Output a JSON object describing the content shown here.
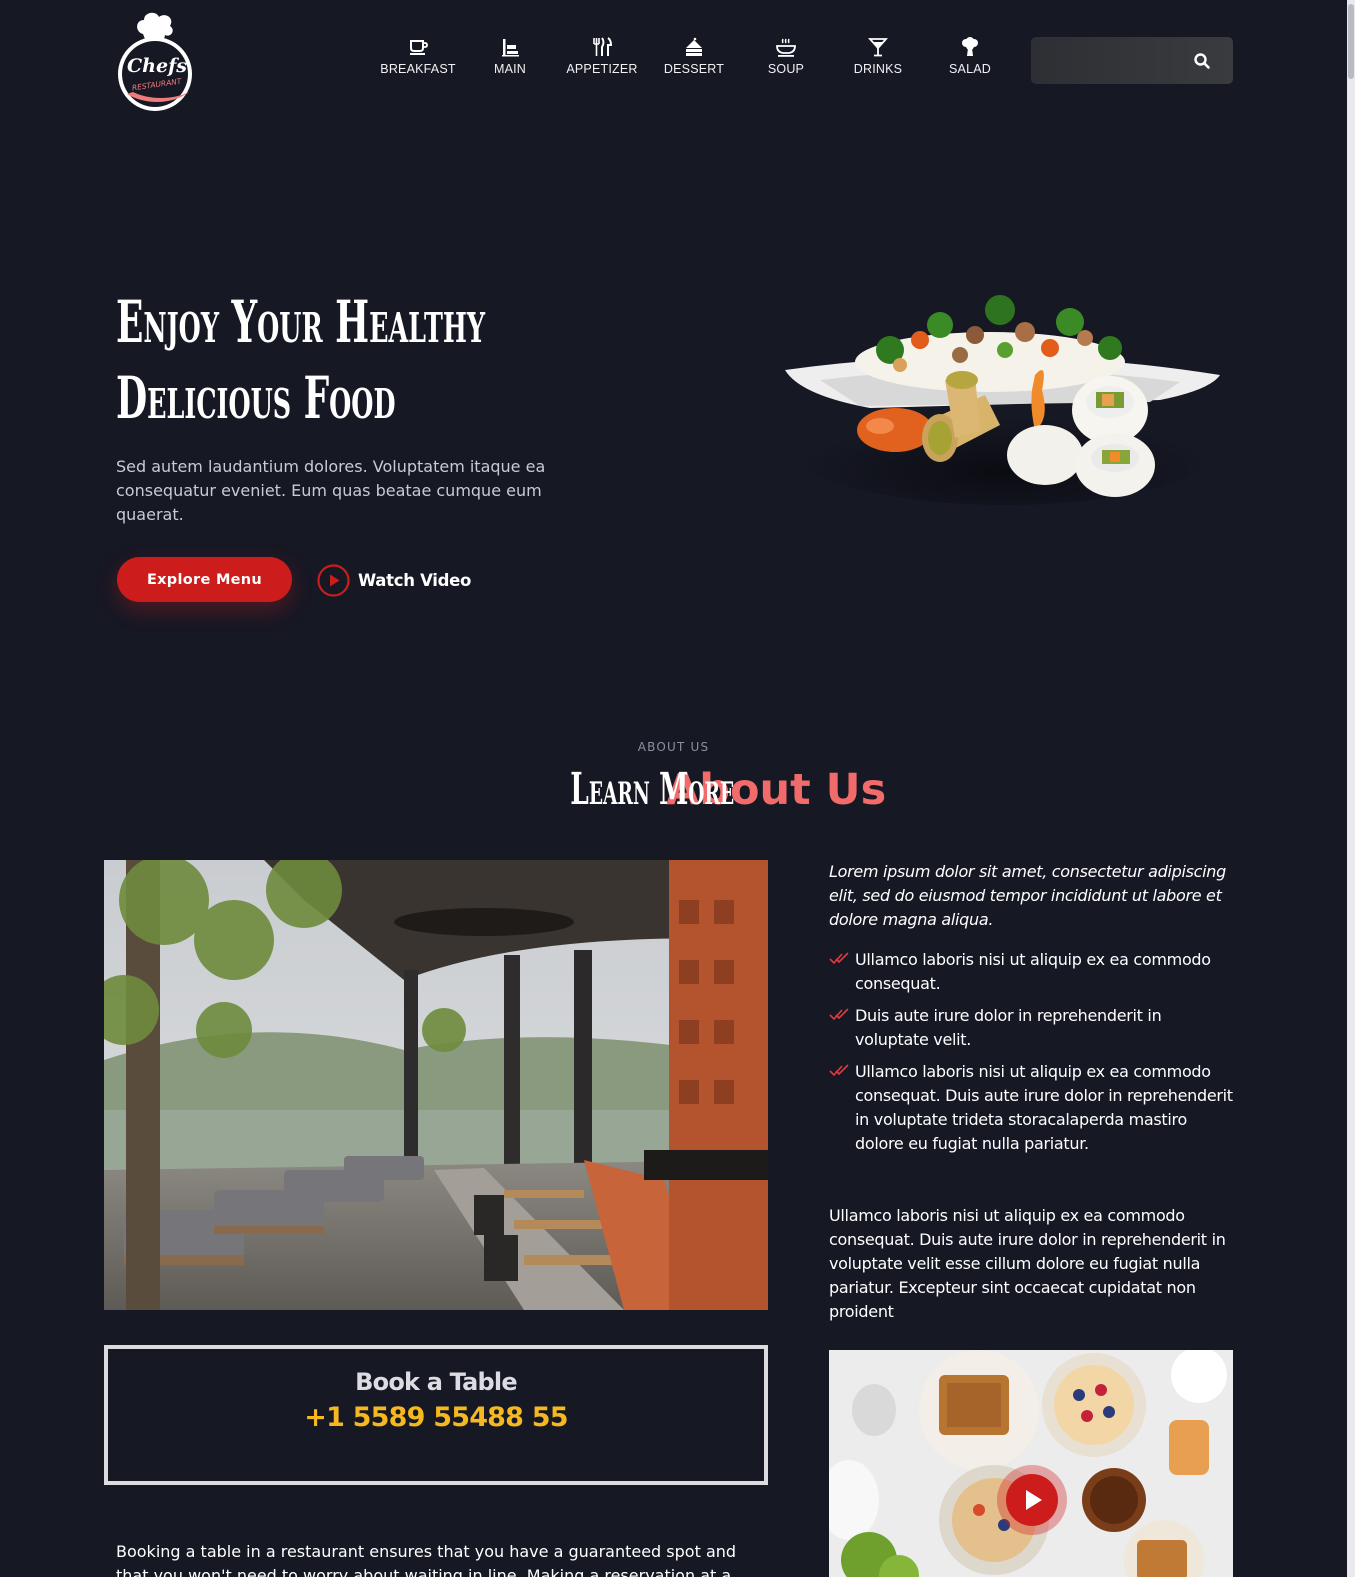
{
  "brand": {
    "logo_text": "Chefs",
    "logo_sub": "RESTAURANT"
  },
  "nav": {
    "items": [
      {
        "label": "BREAKFAST",
        "icon": "coffee-cup-icon"
      },
      {
        "label": "MAIN",
        "icon": "main-dish-icon"
      },
      {
        "label": "APPETIZER",
        "icon": "fork-knife-icon"
      },
      {
        "label": "DESSERT",
        "icon": "cake-icon"
      },
      {
        "label": "SOUP",
        "icon": "soup-bowl-icon"
      },
      {
        "label": "DRINKS",
        "icon": "cocktail-glass-icon"
      },
      {
        "label": "SALAD",
        "icon": "broccoli-icon"
      }
    ]
  },
  "search": {
    "value": "",
    "placeholder": "",
    "icon": "search-icon"
  },
  "hero": {
    "title_line1": "Enjoy Your Healthy",
    "title_line2": "Delicious Food",
    "text": "Sed autem laudantium dolores. Voluptatem itaque ea consequatur eveniet. Eum quas beatae cumque eum quaerat.",
    "explore_label": "Explore Menu",
    "watch_label": "Watch Video"
  },
  "about": {
    "subtitle": "ABOUT US",
    "title_part1": "Learn More",
    "title_part2": "About Us",
    "lead": "Lorem ipsum dolor sit amet, consectetur adipiscing elit, sed do eiusmod tempor incididunt ut labore et dolore magna aliqua.",
    "checks": [
      "Ullamco laboris nisi ut aliquip ex ea commodo consequat.",
      "Duis aute irure dolor in reprehenderit in voluptate velit.",
      "Ullamco laboris nisi ut aliquip ex ea commodo consequat. Duis aute irure dolor in reprehenderit in voluptate trideta storacalaperda mastiro dolore eu fugiat nulla pariatur."
    ],
    "paragraph": "Ullamco laboris nisi ut aliquip ex ea commodo consequat. Duis aute irure dolor in reprehenderit in voluptate velit esse cillum dolore eu fugiat nulla pariatur. Excepteur sint occaecat cupidatat non proident",
    "book_title": "Book a Table",
    "book_phone": "+1 5589 55488 55",
    "bottom_text": "Booking a table in a restaurant ensures that you have a guaranteed spot and that you won't need to worry about waiting in line. Making a reservation at a"
  },
  "colors": {
    "background": "#161824",
    "accent_red": "#cd1c1c",
    "accent_pink": "#f26b6b",
    "phone_yellow": "#f5b820"
  }
}
